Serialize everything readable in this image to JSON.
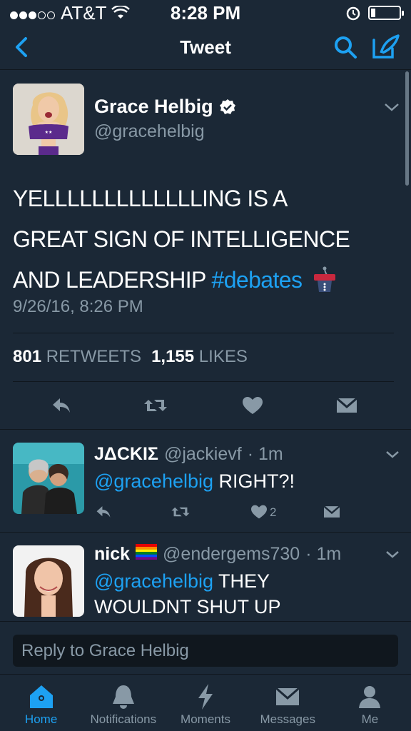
{
  "status_bar": {
    "carrier": "AT&T",
    "time": "8:28 PM"
  },
  "navbar": {
    "title": "Tweet"
  },
  "tweet": {
    "author_name": "Grace Helbig",
    "author_handle": "@gracehelbig",
    "text_line_1": "YELLLLLLLLLLLLLING IS A",
    "text_line_2": "GREAT SIGN OF INTELLIGENCE",
    "text_line_3_a": "AND LEADERSHIP",
    "hashtag": "#debates",
    "timestamp": "9/26/16, 8:26 PM",
    "retweets_count": "801",
    "retweets_label": "RETWEETS",
    "likes_count": "1,155",
    "likes_label": "LIKES"
  },
  "replies": [
    {
      "name": "JΔCKIΣ",
      "handle": "@jackievf",
      "time": "· 1m",
      "mention": "@gracehelbig",
      "text": "RIGHT?!",
      "like_count": "2"
    },
    {
      "name": "nick",
      "flag": "🏳️‍🌈",
      "handle": "@endergems730",
      "time": "· 1m",
      "mention": "@gracehelbig",
      "text": "THEY WOULDNT SHUT UP"
    }
  ],
  "reply_bar": {
    "placeholder": "Reply to Grace Helbig"
  },
  "tabs": [
    {
      "label": "Home",
      "icon": "home-icon",
      "active": true
    },
    {
      "label": "Notifications",
      "icon": "bell-icon"
    },
    {
      "label": "Moments",
      "icon": "lightning-icon"
    },
    {
      "label": "Messages",
      "icon": "envelope-icon"
    },
    {
      "label": "Me",
      "icon": "person-icon"
    }
  ],
  "colors": {
    "background": "#1b2836",
    "accent": "#1da1f2",
    "secondary_text": "#8899a6"
  }
}
